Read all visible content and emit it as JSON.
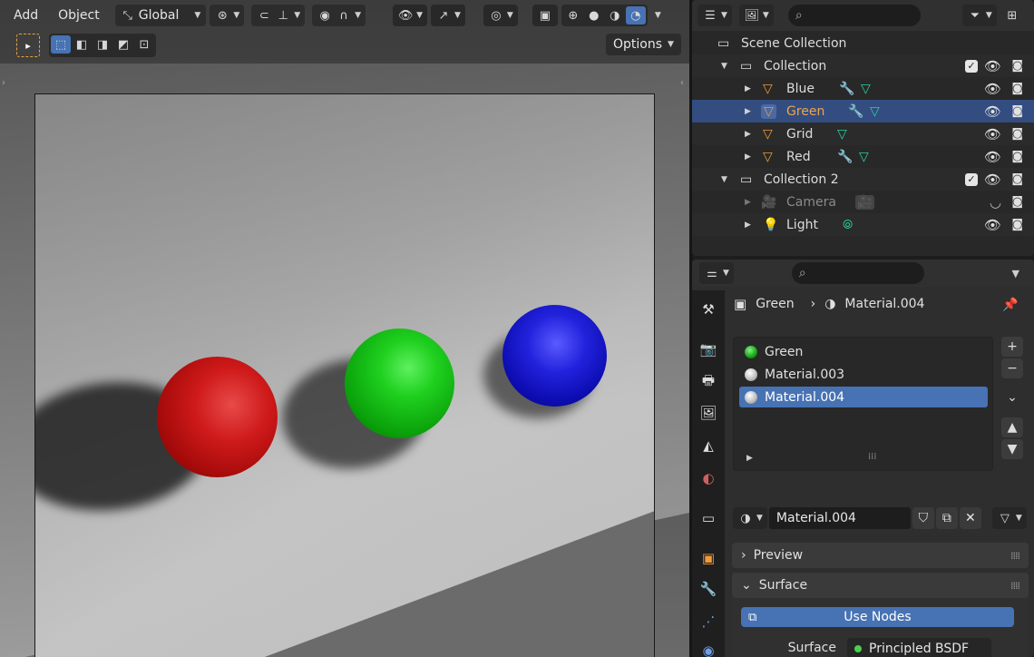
{
  "viewport": {
    "menus": [
      "Add",
      "Object"
    ],
    "transform_orientation": "Global",
    "options_label": "Options"
  },
  "outliner": {
    "rows": [
      {
        "label": "Scene Collection",
        "type": "scene"
      },
      {
        "label": "Collection",
        "type": "collection"
      },
      {
        "label": "Blue",
        "type": "mesh"
      },
      {
        "label": "Green",
        "type": "mesh",
        "selected": true
      },
      {
        "label": "Grid",
        "type": "mesh"
      },
      {
        "label": "Red",
        "type": "mesh"
      },
      {
        "label": "Collection 2",
        "type": "collection"
      },
      {
        "label": "Camera",
        "type": "camera"
      },
      {
        "label": "Light",
        "type": "light"
      }
    ]
  },
  "properties": {
    "breadcrumb_object": "Green",
    "breadcrumb_material": "Material.004",
    "slots": [
      {
        "label": "Green",
        "color": "#1fb51f"
      },
      {
        "label": "Material.003",
        "color": "#d0d0d0"
      },
      {
        "label": "Material.004",
        "color": "#d0d0d0"
      }
    ],
    "material_name": "Material.004",
    "panels": {
      "preview": "Preview",
      "surface": "Surface"
    },
    "use_nodes_label": "Use Nodes",
    "surface_label": "Surface",
    "surface_value": "Principled BSDF"
  },
  "colors": {
    "accent": "#4772b3",
    "selection": "#334d80",
    "selected_text": "#f0a44a",
    "sphere_red": "#c81414",
    "sphere_green": "#14c814",
    "sphere_blue": "#1414c8"
  }
}
